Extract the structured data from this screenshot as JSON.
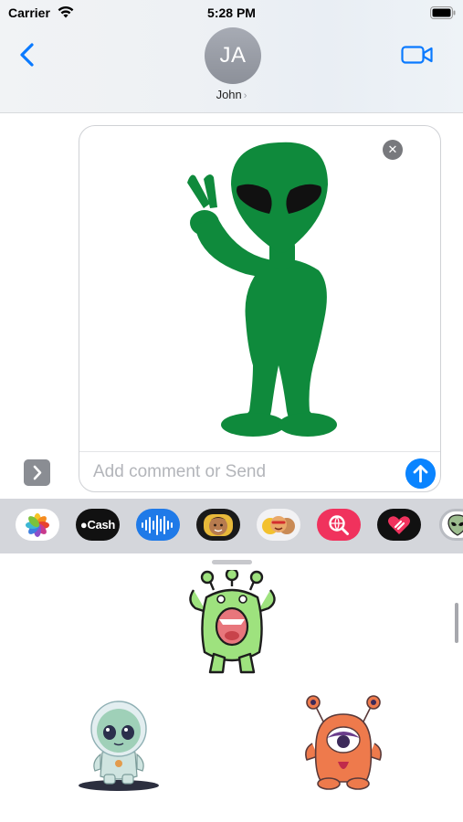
{
  "status_bar": {
    "carrier": "Carrier",
    "time": "5:28 PM"
  },
  "header": {
    "avatar_initials": "JA",
    "contact_name": "John",
    "name_chevron": "›"
  },
  "compose": {
    "placeholder": "Add comment or Send",
    "remove_glyph": "✕"
  },
  "app_drawer": {
    "cash_label": "Cash"
  },
  "icons": {
    "back": "chevron-left-icon",
    "video": "video-camera-icon",
    "send": "arrow-up-icon",
    "expand": "chevron-right-icon",
    "photos": "photos-icon",
    "wifi": "wifi-icon",
    "battery": "battery-icon"
  },
  "colors": {
    "accent": "#0a84ff",
    "alien_green": "#0f8a3c"
  }
}
